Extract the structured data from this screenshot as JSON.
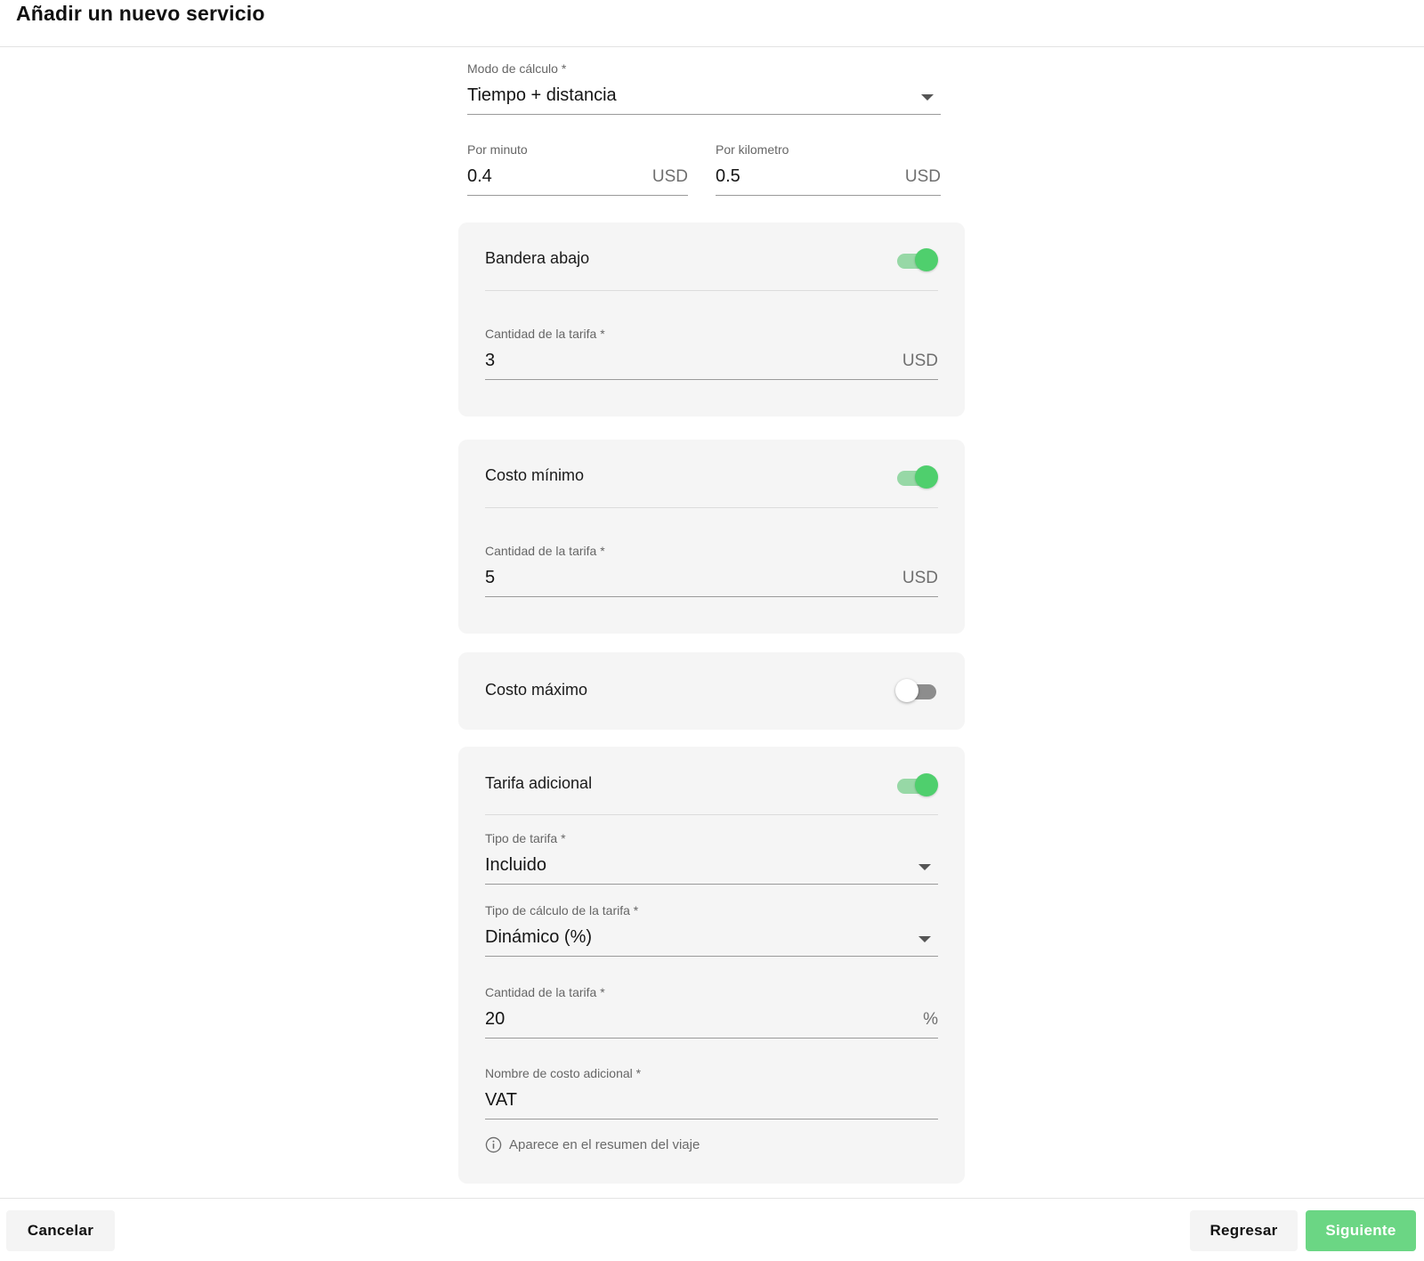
{
  "header": {
    "title": "Añadir un nuevo servicio"
  },
  "calc_mode": {
    "label": "Modo de cálculo *",
    "value": "Tiempo + distancia"
  },
  "per_minute": {
    "label": "Por minuto",
    "value": "0.4",
    "unit": "USD"
  },
  "per_km": {
    "label": "Por kilometro",
    "value": "0.5",
    "unit": "USD"
  },
  "flag_down": {
    "title": "Bandera abajo",
    "enabled": true,
    "amount": {
      "label": "Cantidad de la tarifa *",
      "value": "3",
      "unit": "USD"
    }
  },
  "min_cost": {
    "title": "Costo mínimo",
    "enabled": true,
    "amount": {
      "label": "Cantidad de la tarifa *",
      "value": "5",
      "unit": "USD"
    }
  },
  "max_cost": {
    "title": "Costo máximo",
    "enabled": false
  },
  "extra_fee": {
    "title": "Tarifa adicional",
    "enabled": true,
    "fee_type": {
      "label": "Tipo de tarifa *",
      "value": "Incluido"
    },
    "calc_type": {
      "label": "Tipo de cálculo de la tarifa *",
      "value": "Dinámico (%)"
    },
    "amount": {
      "label": "Cantidad de la tarifa *",
      "value": "20",
      "unit": "%"
    },
    "name": {
      "label": "Nombre de costo adicional *",
      "value": "VAT"
    },
    "helper": "Aparece en el resumen del viaje"
  },
  "footer": {
    "cancel": "Cancelar",
    "back": "Regresar",
    "next": "Siguiente"
  },
  "colors": {
    "accent": "#4fcf6d",
    "accent_track": "#97d8a6",
    "next_button": "#6bd684",
    "card_bg": "#f5f5f5"
  },
  "icons": {
    "dropdown": "caret-down-icon",
    "info": "info-icon"
  }
}
